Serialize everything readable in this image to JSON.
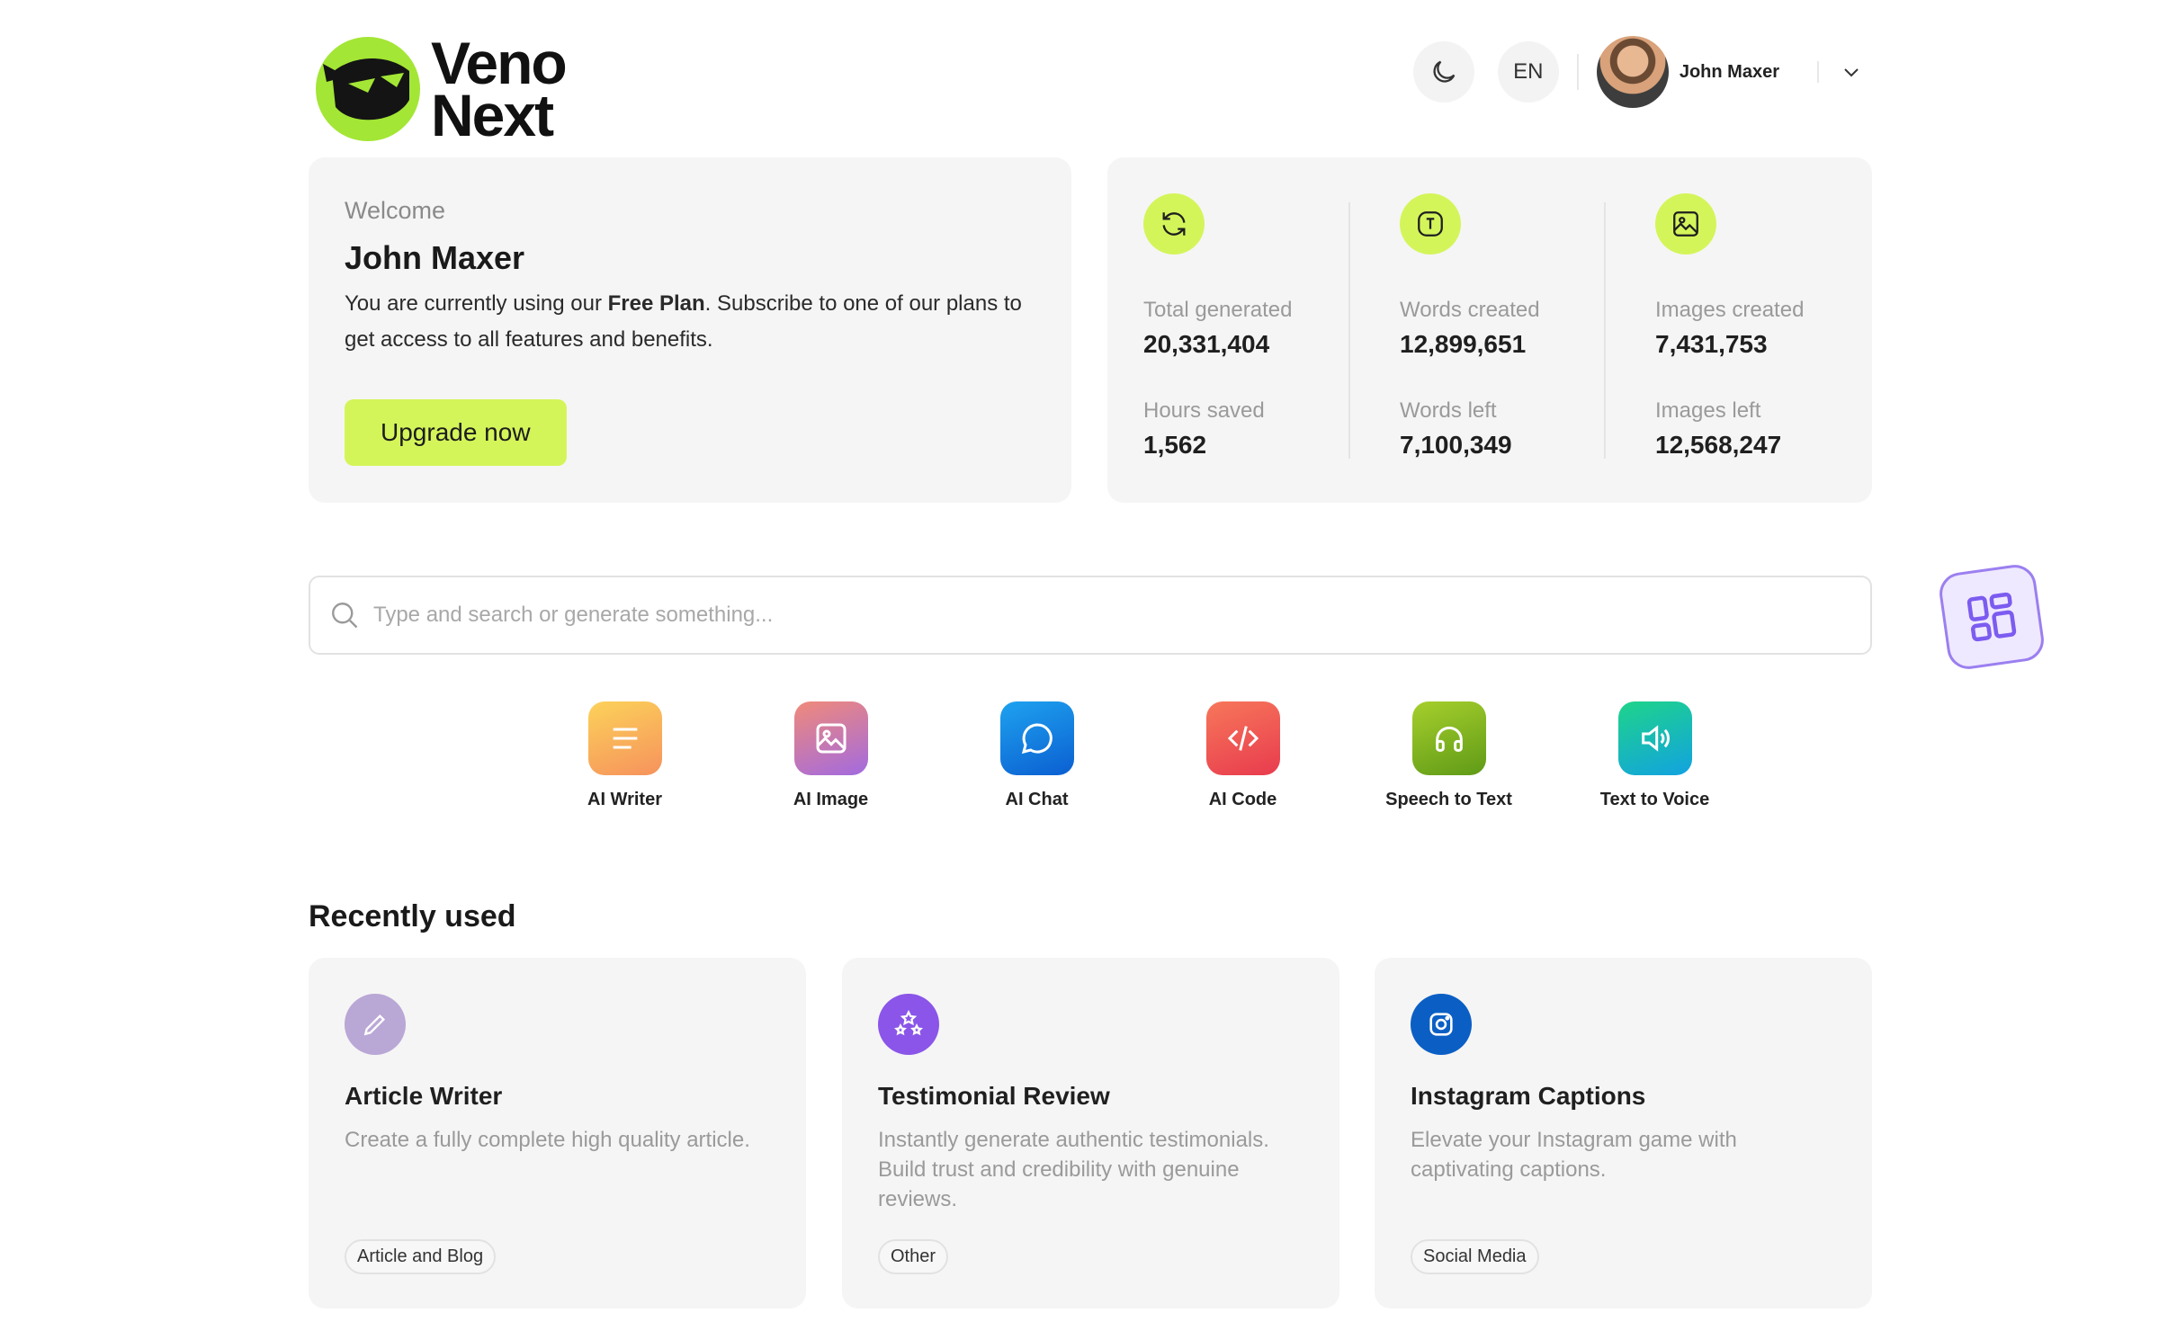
{
  "brand": {
    "line1": "Veno",
    "line2": "Next",
    "accent": "#a3e635"
  },
  "header": {
    "theme_icon": "moon-icon",
    "language": "EN",
    "user_name": "John Maxer",
    "menu_icon": "chevron-down-icon"
  },
  "welcome": {
    "kicker": "Welcome",
    "name": "John Maxer",
    "desc_before": "You are currently using our ",
    "plan": "Free Plan",
    "desc_after": ". Subscribe to one of our plans to get access to all features and benefits.",
    "cta": "Upgrade now"
  },
  "stats": {
    "columns": [
      {
        "icon": "refresh-icon",
        "top": {
          "label": "Total generated",
          "value": "20,331,404"
        },
        "bottom": {
          "label": "Hours saved",
          "value": "1,562"
        }
      },
      {
        "icon": "text-icon",
        "top": {
          "label": "Words created",
          "value": "12,899,651"
        },
        "bottom": {
          "label": "Words left",
          "value": "7,100,349"
        }
      },
      {
        "icon": "image-icon",
        "top": {
          "label": "Images created",
          "value": "7,431,753"
        },
        "bottom": {
          "label": "Images left",
          "value": "12,568,247"
        }
      }
    ]
  },
  "search": {
    "placeholder": "Type and search or generate something..."
  },
  "tools": [
    {
      "label": "AI Writer",
      "icon": "lines-icon"
    },
    {
      "label": "AI Image",
      "icon": "image-icon"
    },
    {
      "label": "AI Chat",
      "icon": "chat-bubble-icon"
    },
    {
      "label": "AI Code",
      "icon": "code-icon"
    },
    {
      "label": "Speech to Text",
      "icon": "headphones-icon"
    },
    {
      "label": "Text to Voice",
      "icon": "speaker-icon"
    }
  ],
  "recent": {
    "title": "Recently used",
    "items": [
      {
        "title": "Article Writer",
        "desc": "Create a fully complete high quality article.",
        "tag": "Article and Blog",
        "icon": "pencil-icon"
      },
      {
        "title": "Testimonial Review",
        "desc": "Instantly generate authentic testimonials. Build trust and credibility with genuine reviews.",
        "tag": "Other",
        "icon": "stars-icon"
      },
      {
        "title": "Instagram Captions",
        "desc": "Elevate your Instagram game with captivating captions.",
        "tag": "Social Media",
        "icon": "instagram-icon"
      }
    ]
  }
}
